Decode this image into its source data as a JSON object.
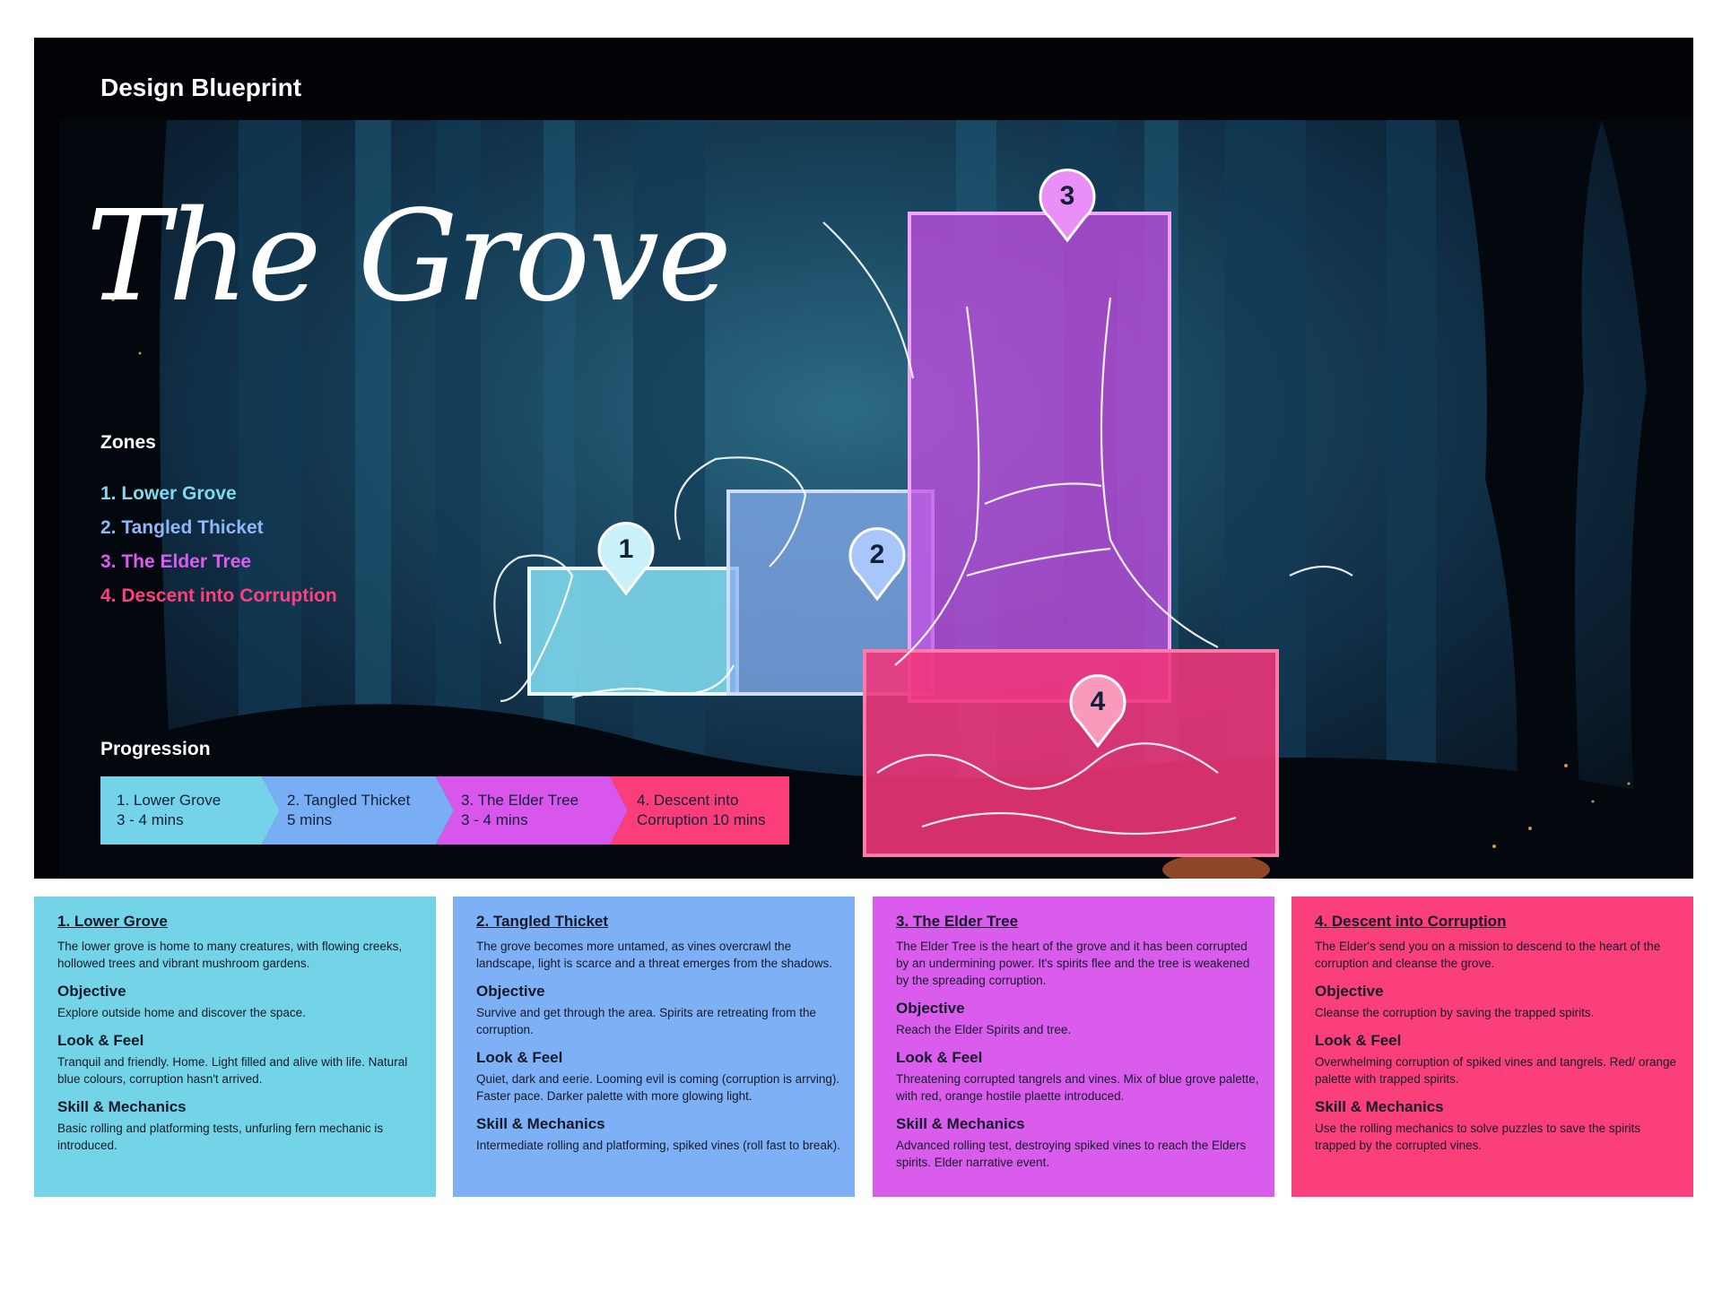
{
  "header": {
    "title": "Design Blueprint"
  },
  "hero": {
    "title": "The Grove"
  },
  "zones": {
    "heading": "Zones",
    "items": [
      {
        "label": "1. Lower Grove",
        "color": "#7fd8ec"
      },
      {
        "label": "2. Tangled Thicket",
        "color": "#8fb6f5"
      },
      {
        "label": "3. The Elder Tree",
        "color": "#dc5cf0"
      },
      {
        "label": "4. Descent into Corruption",
        "color": "#ff3f7e"
      }
    ]
  },
  "markers": [
    "1",
    "2",
    "3",
    "4"
  ],
  "progression": {
    "heading": "Progression",
    "steps": [
      {
        "line1": "1. Lower Grove",
        "line2": "3 - 4 mins",
        "color": "#74d3e8"
      },
      {
        "line1": "2. Tangled Thicket",
        "line2": "5 mins",
        "color": "#7aaef4"
      },
      {
        "line1": "3. The Elder Tree",
        "line2": "3 - 4 mins",
        "color": "#d856ec"
      },
      {
        "line1": "4. Descent into",
        "line2": "Corruption 10 mins",
        "color": "#fb3d7a"
      }
    ]
  },
  "cards": [
    {
      "color": "#72d4e6",
      "title": "1. Lower Grove",
      "description": "The lower grove is home to many creatures, with flowing creeks, hollowed trees and vibrant mushroom gardens.",
      "objective_heading": "Objective",
      "objective": "Explore outside home and discover the space.",
      "look_heading": "Look & Feel",
      "look": "Tranquil and friendly. Home. Light filled and alive with life. Natural blue colours, corruption hasn't arrived.",
      "skill_heading": "Skill & Mechanics",
      "skill": "Basic rolling and platforming tests, unfurling fern mechanic is introduced."
    },
    {
      "color": "#7db0f4",
      "title": "2. Tangled Thicket",
      "description": "The grove becomes more untamed, as vines overcrawl the landscape, light is scarce and a threat emerges from the shadows.",
      "objective_heading": "Objective",
      "objective": "Survive and get through the area. Spirits are retreating from the corruption.",
      "look_heading": "Look & Feel",
      "look": "Quiet, dark and eerie. Looming evil is coming (corruption is arrving). Faster pace. Darker palette with more glowing light.",
      "skill_heading": "Skill & Mechanics",
      "skill": "Intermediate rolling and platforming, spiked vines (roll fast to break)."
    },
    {
      "color": "#d95ced",
      "title": "3. The Elder Tree",
      "description": "The Elder Tree is the heart of the grove and it has been corrupted by an undermining power. It's spirits flee and the tree is weakened by the spreading corruption.",
      "objective_heading": "Objective",
      "objective": "Reach the Elder Spirits and tree.",
      "look_heading": "Look & Feel",
      "look": "Threatening corrupted tangrels and vines. Mix of blue grove palette, with red, orange hostile plaette introduced.",
      "skill_heading": "Skill & Mechanics",
      "skill": "Advanced rolling test, destroying spiked vines to reach the Elders spirits. Elder narrative event."
    },
    {
      "color": "#fb3f7b",
      "title": "4. Descent into Corruption",
      "description": "The Elder's send you on a mission to descend to the heart of the corruption and cleanse the grove.",
      "objective_heading": "Objective",
      "objective": "Cleanse the corruption by saving the trapped spirits.",
      "look_heading": "Look & Feel",
      "look": "Overwhelming corruption of spiked vines and tangrels. Red/ orange palette with trapped spirits.",
      "skill_heading": "Skill & Mechanics",
      "skill": "Use the rolling mechanics to solve puzzles to save the spirits trapped by the corrupted vines."
    }
  ]
}
